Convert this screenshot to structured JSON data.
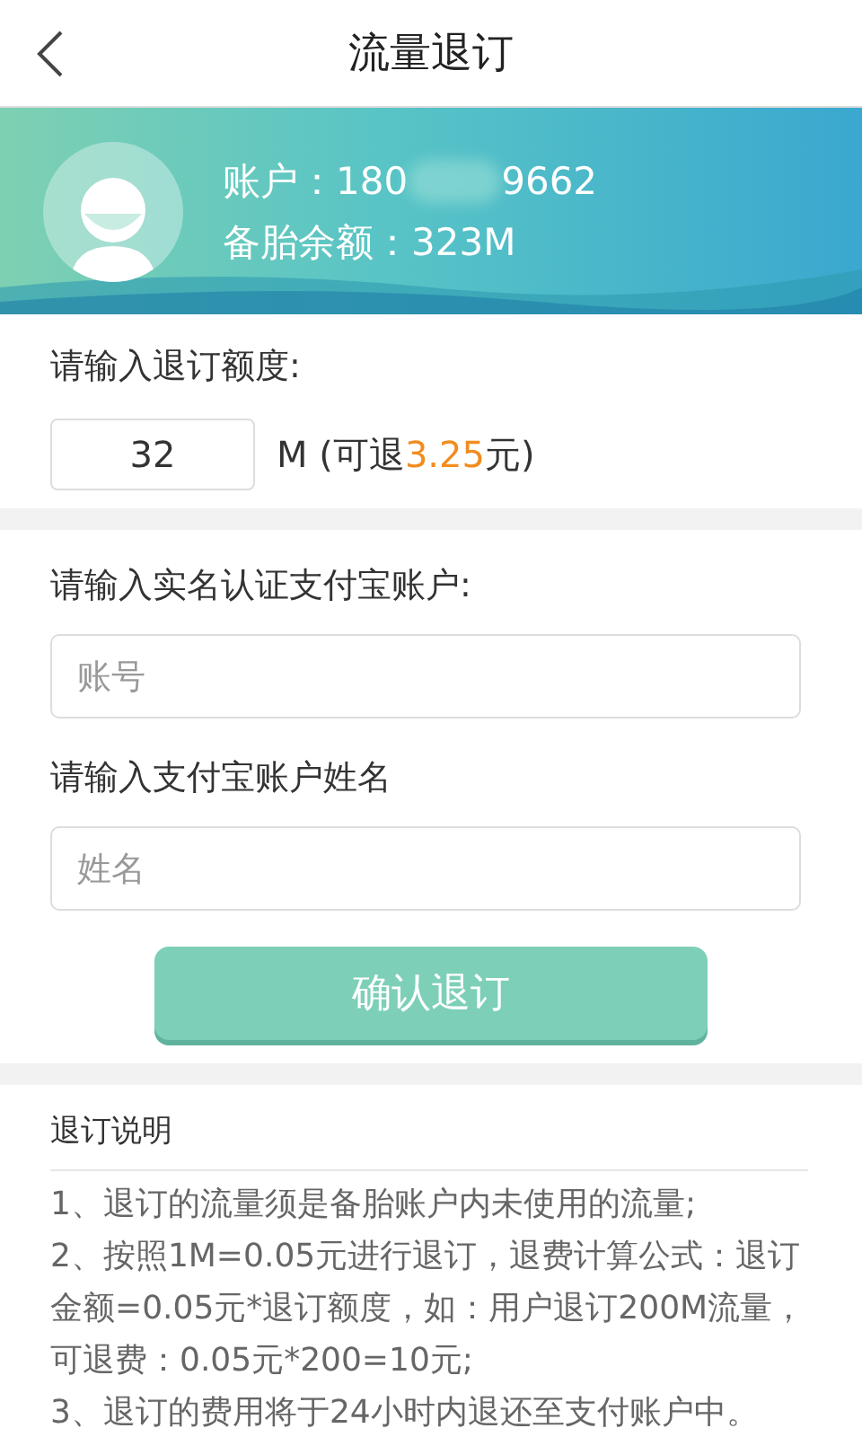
{
  "header": {
    "title": "流量退订"
  },
  "account": {
    "label": "账户：",
    "number_start": "180",
    "number_end": "9662",
    "balance_label": "备胎余额：",
    "balance": "323M"
  },
  "unsubscribe": {
    "label": "请输入退订额度:",
    "amount": "32",
    "unit": "M",
    "refund_open": "(可退",
    "refund_value": "3.25",
    "refund_close": "元)"
  },
  "alipay": {
    "account_label": "请输入实名认证支付宝账户:",
    "account_placeholder": "账号",
    "name_label": "请输入支付宝账户姓名",
    "name_placeholder": "姓名",
    "confirm": "确认退订"
  },
  "notes": {
    "title": "退订说明",
    "items": [
      "1、退订的流量须是备胎账户内未使用的流量;",
      "2、按照1M=0.05元进行退订，退费计算公式：退订金额=0.05元*退订额度，如：用户退订200M流量，可退费：0.05元*200=10元;",
      "3、退订的费用将于24小时内退还至支付账户中。"
    ]
  }
}
